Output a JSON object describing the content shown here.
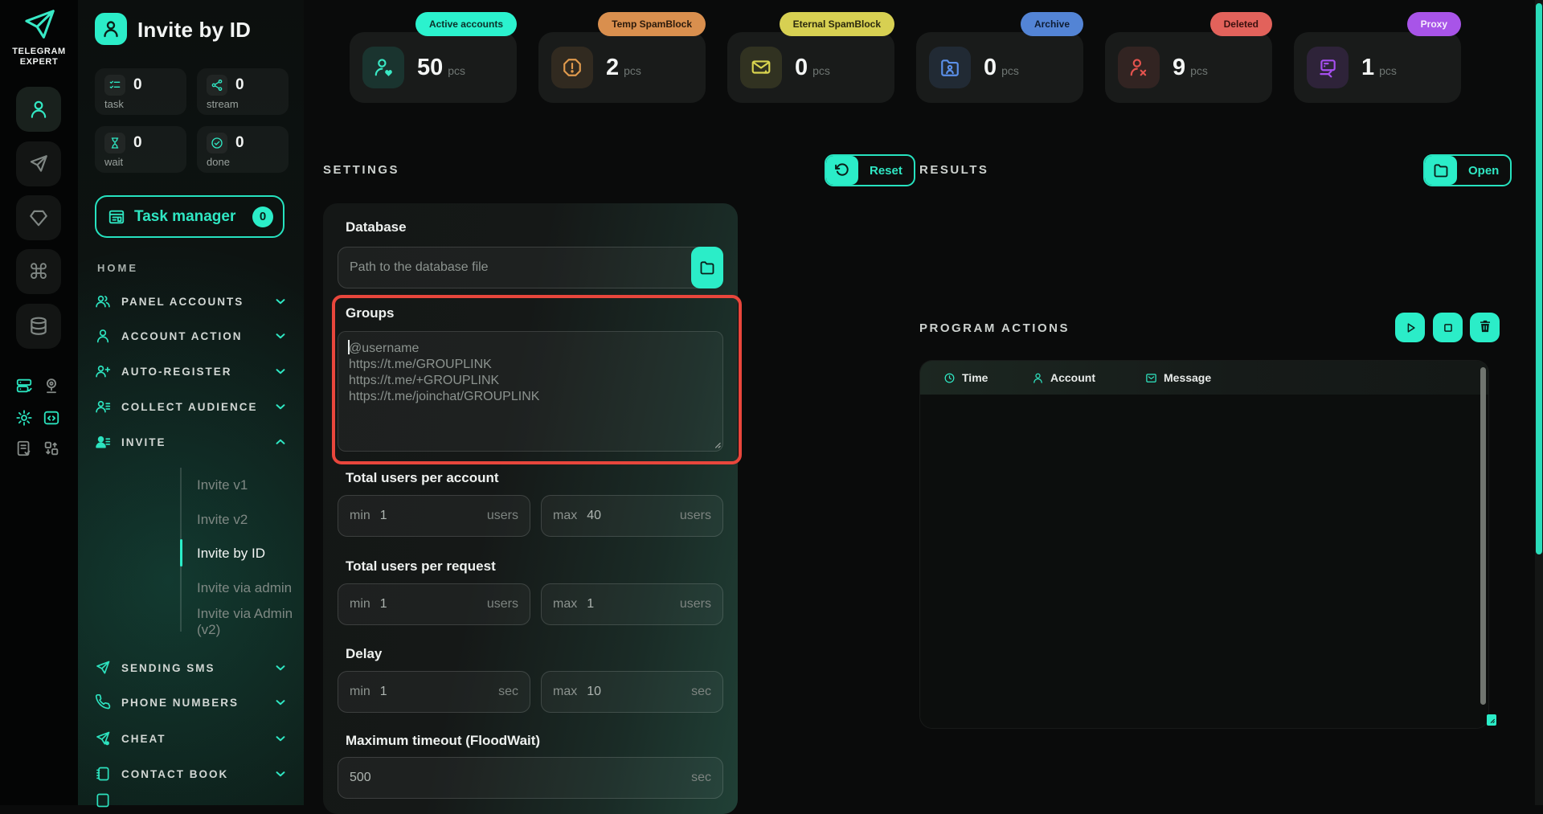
{
  "accent": "#2bedc8",
  "brand": {
    "line1": "TELEGRAM",
    "line2": "EXPERT"
  },
  "sidebar": {
    "title": "Invite by ID",
    "counters": [
      {
        "label": "task",
        "value": "0"
      },
      {
        "label": "stream",
        "value": "0"
      },
      {
        "label": "wait",
        "value": "0"
      },
      {
        "label": "done",
        "value": "0"
      }
    ],
    "task_manager": {
      "label": "Task manager",
      "badge": "0"
    },
    "section_label": "HOME",
    "nav": [
      {
        "label": "PANEL ACCOUNTS"
      },
      {
        "label": "ACCOUNT ACTION"
      },
      {
        "label": "AUTO-REGISTER"
      },
      {
        "label": "COLLECT AUDIENCE"
      },
      {
        "label": "INVITE"
      },
      {
        "label": "SENDING SMS"
      },
      {
        "label": "PHONE NUMBERS"
      },
      {
        "label": "CHEAT"
      },
      {
        "label": "CONTACT BOOK"
      }
    ],
    "invite_children": [
      {
        "label": "Invite v1"
      },
      {
        "label": "Invite v2"
      },
      {
        "label": "Invite by ID",
        "active": true
      },
      {
        "label": "Invite via admin"
      },
      {
        "label": "Invite via Admin (v2)"
      }
    ]
  },
  "cards": [
    {
      "badge": "Active accounts",
      "value": "50",
      "unit": "pcs",
      "color": "#2bf2ce"
    },
    {
      "badge": "Temp SpamBlock",
      "value": "2",
      "unit": "pcs",
      "color": "#d98f4e"
    },
    {
      "badge": "Eternal SpamBlock",
      "value": "0",
      "unit": "pcs",
      "color": "#d7d052"
    },
    {
      "badge": "Archive",
      "value": "0",
      "unit": "pcs",
      "color": "#5384d5"
    },
    {
      "badge": "Deleted",
      "value": "9",
      "unit": "pcs",
      "color": "#e2625b"
    },
    {
      "badge": "Proxy",
      "value": "1",
      "unit": "pcs",
      "color": "#a854e8"
    }
  ],
  "settings": {
    "title": "SETTINGS",
    "reset_label": "Reset",
    "database": {
      "label": "Database",
      "placeholder": "Path to the database file"
    },
    "groups": {
      "label": "Groups",
      "placeholder": "@username\nhttps://t.me/GROUPLINK\nhttps://t.me/+GROUPLINK\nhttps://t.me/joinchat/GROUPLINK"
    },
    "fields": [
      {
        "label": "Total users per account",
        "min_label": "min",
        "min_value": "1",
        "max_label": "max",
        "max_value": "40",
        "unit": "users"
      },
      {
        "label": "Total users per request",
        "min_label": "min",
        "min_value": "1",
        "max_label": "max",
        "max_value": "1",
        "unit": "users"
      },
      {
        "label": "Delay",
        "min_label": "min",
        "min_value": "1",
        "max_label": "max",
        "max_value": "10",
        "unit": "sec"
      }
    ],
    "timeout": {
      "label": "Maximum timeout (FloodWait)",
      "value": "500",
      "unit": "sec"
    }
  },
  "results": {
    "title": "RESULTS",
    "open_label": "Open"
  },
  "program_actions": {
    "title": "PROGRAM ACTIONS",
    "columns": [
      {
        "label": "Time"
      },
      {
        "label": "Account"
      },
      {
        "label": "Message"
      }
    ]
  }
}
